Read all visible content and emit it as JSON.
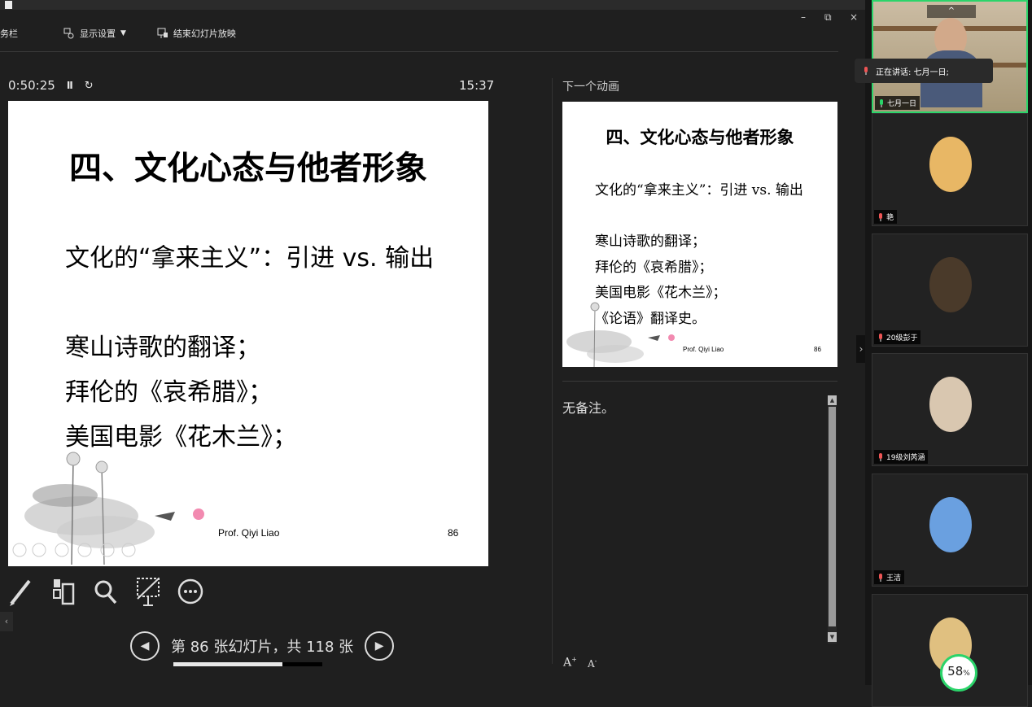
{
  "toolbar": {
    "taskbar_label": "务栏",
    "display_settings": "显示设置",
    "display_settings_caret": "▼",
    "end_show": "结束幻灯片放映",
    "win_minimize": "–",
    "win_restore": "⧉",
    "win_close": "×"
  },
  "timer": {
    "elapsed": "0:50:25",
    "pause_icon": "Ⅱ",
    "reset_icon": "↻",
    "clock": "15:37"
  },
  "current_slide": {
    "title": "四、文化心态与他者形象",
    "lines": [
      "文化的“拿来主义”：引进 vs. 输出",
      "寒山诗歌的翻译；",
      "拜伦的《哀希腊》；",
      "美国电影《花木兰》；"
    ],
    "credit": "Prof. Qiyi Liao",
    "page_number": "86"
  },
  "next": {
    "label": "下一个动画",
    "title": "四、文化心态与他者形象",
    "lines": [
      "文化的“拿来主义”：引进 vs. 输出",
      "寒山诗歌的翻译；",
      "拜伦的《哀希腊》；",
      "美国电影《花木兰》；",
      "《论语》翻译史。"
    ],
    "credit": "Prof. Qiyi Liao",
    "page_number": "86"
  },
  "notes": {
    "text": "无备注。",
    "font_increase": "A",
    "font_decrease": "A"
  },
  "navigation": {
    "prev_icon": "◀",
    "next_icon": "▶",
    "slide_counter": "第 86 张幻灯片，共 118 张",
    "progress": 0.73
  },
  "sidebar_toggle": "‹",
  "gallery": {
    "collapse_icon": "›",
    "speaking_now": "正在讲话: 七月一日;",
    "scroll_up": "^",
    "participants": [
      {
        "name": "七月一日",
        "active": true,
        "avatar_color": "#c9b79a"
      },
      {
        "name": "艳",
        "active": false,
        "avatar_color": "#e8b765"
      },
      {
        "name": "20级彭于",
        "active": false,
        "avatar_color": "#4a3a2a"
      },
      {
        "name": "19级刘芮涵",
        "active": false,
        "avatar_color": "#d9c7b0"
      },
      {
        "name": "王洁",
        "active": false,
        "avatar_color": "#6aa0e0"
      },
      {
        "name": "",
        "active": false,
        "avatar_color": "#e0c080"
      }
    ],
    "percent_badge": "58",
    "percent_unit": "%"
  },
  "colors": {
    "accent_green": "#2bd46a",
    "background": "#1f1f1f"
  }
}
